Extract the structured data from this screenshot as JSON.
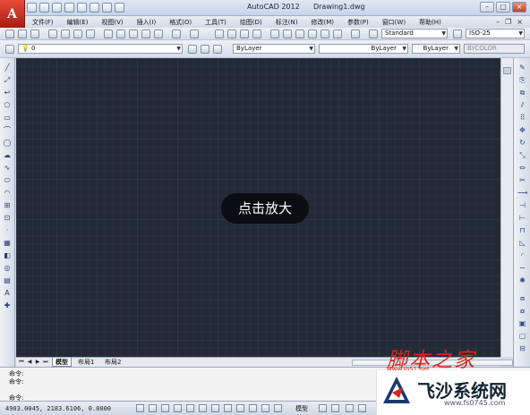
{
  "window": {
    "app_title": "AutoCAD 2012",
    "document_title": "Drawing1.dwg",
    "logo_letter": "A"
  },
  "menu": {
    "items": [
      "文件(F)",
      "编辑(E)",
      "视图(V)",
      "插入(I)",
      "格式(O)",
      "工具(T)",
      "绘图(D)",
      "标注(N)",
      "修改(M)",
      "参数(P)",
      "窗口(W)",
      "帮助(H)"
    ]
  },
  "toolbar": {
    "text_style": "Standard",
    "dim_style": "ISO-25",
    "layer": "0",
    "color": "ByLayer",
    "linetype": "ByLayer",
    "lineweight": "ByLayer",
    "plot_style": "BYCOLOR"
  },
  "canvas": {
    "zoom_overlay_text": "点击放大",
    "background_color": "#232a36"
  },
  "layout_tabs": {
    "tabs": [
      "模型",
      "布局1",
      "布局2"
    ],
    "active": "模型"
  },
  "command": {
    "history": [
      "命令:",
      "命令:"
    ],
    "prompt": "命令:"
  },
  "status": {
    "coordinates": "4903.0045, 2183.6106, 0.0000",
    "model_label": "模型"
  },
  "watermarks": {
    "jiaoben_text": "脚本之家",
    "jiaoben_url": "www.jb51.net",
    "feisha_name": "飞沙系统网",
    "feisha_url": "www.fs0745.com",
    "accent_red": "#d7261e"
  }
}
